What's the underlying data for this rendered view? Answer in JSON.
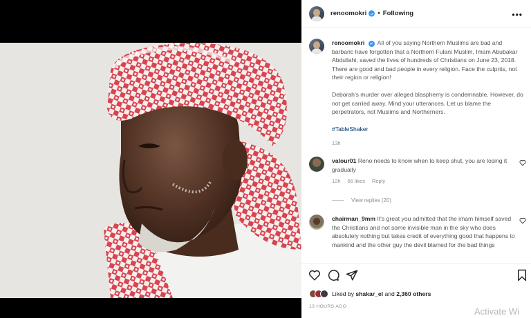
{
  "post": {
    "username": "renoomokri",
    "follow_separator": "•",
    "follow_status": "Following",
    "more_label": "•••"
  },
  "caption": {
    "username": "renoomokri",
    "paragraph1": "All of you saying Northern Muslims are bad and barbaric have forgotten that a Northern Fulani Muslim, Imam Abubakar Abdullahi, saved the lives of hundreds of Christians on June 23, 2018. There are good and bad people in every religion. Face the culprits, not their region or religion!",
    "paragraph2": "Deborah's murder over alleged blasphemy is condemnable. However, do not get carried away. Mind your utterances. Let us blame the perpetrators, not Muslims and Northerners.",
    "hashtag": "#TableShaker",
    "time": "13h"
  },
  "comments": [
    {
      "username": "valour01",
      "text": "Reno needs to know when to keep shut, you are losing it gradually",
      "time": "12h",
      "likes": "66 likes",
      "reply_label": "Reply",
      "view_replies": "View replies (20)"
    },
    {
      "username": "chairman_9mm",
      "text": "It's great you admitted that the imam himself saved the Christians and not some invisible man in the sky who does absolutely nothing but takes credit of everything good that happens to mankind and the other guy the devil blamed for the bad things"
    }
  ],
  "footer": {
    "liked_by_prefix": "Liked by",
    "liked_by_user": "shakar_el",
    "liked_by_and": "and",
    "liked_by_count": "2,360 others",
    "timeago": "13 HOURS AGO"
  },
  "watermark": "Activate Wi",
  "colors": {
    "verified": "#3897f0",
    "hashtag": "#00376b",
    "meta_gray": "#8e8e8e"
  },
  "icons": [
    "more-options-icon",
    "verified-badge-icon",
    "heart-icon",
    "comment-icon",
    "share-icon",
    "bookmark-icon"
  ]
}
